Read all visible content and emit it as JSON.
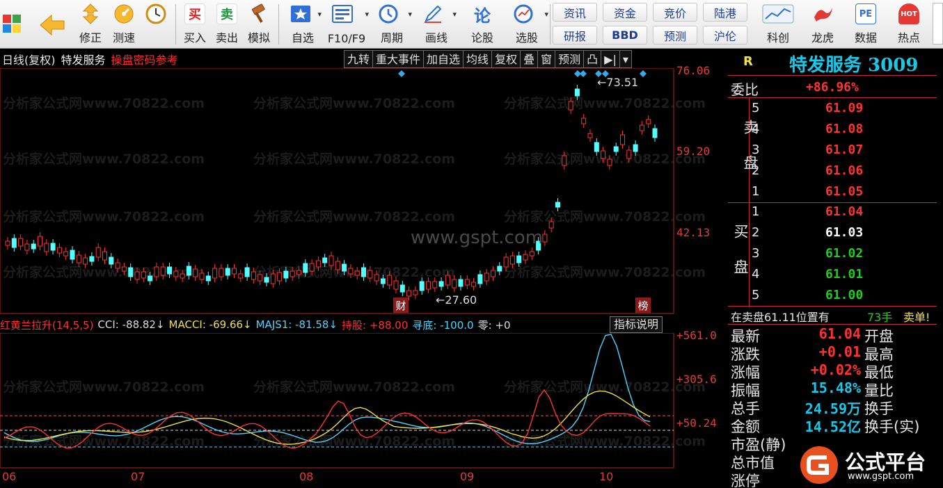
{
  "toolbar": {
    "buttons": [
      {
        "label": "",
        "icon": "windows-grid-icon"
      },
      {
        "label": "",
        "icon": "back-arrow-icon"
      },
      {
        "label": "修正",
        "icon": "up-down-arrows-icon"
      },
      {
        "label": "测速",
        "icon": "speed-dial-icon"
      },
      {
        "label": "买入",
        "icon": "buy-icon",
        "glyph": "买"
      },
      {
        "label": "卖出",
        "icon": "sell-icon",
        "glyph": "卖"
      },
      {
        "label": "模拟",
        "icon": "hammer-icon"
      },
      {
        "label": "自选",
        "icon": "star-icon"
      },
      {
        "label": "F10/F9",
        "icon": "info-card-icon"
      },
      {
        "label": "周期",
        "icon": "clock-icon"
      },
      {
        "label": "画线",
        "icon": "pencil-icon"
      },
      {
        "label": "论股",
        "icon": "discuss-icon",
        "glyph": "论"
      },
      {
        "label": "选股",
        "icon": "chart-select-icon"
      },
      {
        "label": "科创",
        "icon": "chart-icon"
      },
      {
        "label": "龙虎",
        "icon": "dragon-icon"
      },
      {
        "label": "数据",
        "icon": "pe-icon",
        "glyph": "PE"
      },
      {
        "label": "热点",
        "icon": "hot-icon",
        "glyph": "HOT"
      }
    ],
    "quick_row1": [
      "资讯",
      "资金",
      "竞价",
      "陆港"
    ],
    "quick_row2": [
      "研报",
      "BBD",
      "预测",
      "沪伦"
    ]
  },
  "chart": {
    "period": "日线(复权)",
    "stock_name": "特发服务",
    "hint": "操盘密码参考",
    "menu": [
      "九转",
      "重大事件",
      "加自选",
      "均线",
      "复权",
      "叠",
      "窗",
      "预测",
      "凸",
      "▶|",
      "▾"
    ],
    "price_axis": [
      "76.06",
      "59.20",
      "42.13"
    ],
    "high_label": "←73.51",
    "low_label": "←27.60",
    "marker_cai": "财",
    "marker_bang": "榜",
    "watermark": "分析家公式网www.70822.com",
    "center_watermark": "www.gspt.com",
    "months": [
      "06",
      "07",
      "08",
      "09",
      "10"
    ]
  },
  "indicator": {
    "name": "红黄兰拉升(14,5,5)",
    "cci": "CCI: -88.82↓",
    "macci": "MACCI: -69.66↓",
    "majs": "MAJS1: -81.58↓",
    "hold": "持股: +88.00",
    "bottom": "寻底: -100.0",
    "zero": "零: +0",
    "help_button": "指标说明",
    "axis": [
      "+561.0",
      "+305.6",
      "+50.24"
    ]
  },
  "quote": {
    "r_label": "R",
    "title": "特发服务 3009",
    "weibi_label": "委比",
    "weibi": "+86.96%",
    "sell_label": "卖盘",
    "buy_label": "买盘",
    "sell": [
      {
        "lvl": "5",
        "price": "61.09"
      },
      {
        "lvl": "4",
        "price": "61.08"
      },
      {
        "lvl": "3",
        "price": "61.07"
      },
      {
        "lvl": "2",
        "price": "61.06"
      },
      {
        "lvl": "1",
        "price": "61.05"
      }
    ],
    "buy": [
      {
        "lvl": "1",
        "price": "61.04"
      },
      {
        "lvl": "2",
        "price": "61.03"
      },
      {
        "lvl": "3",
        "price": "61.02"
      },
      {
        "lvl": "4",
        "price": "61.01"
      },
      {
        "lvl": "5",
        "price": "61.00"
      }
    ],
    "big_order": {
      "text": "在卖盘61.11位置有",
      "qty": "73手",
      "tag": "卖单!"
    },
    "stats": [
      {
        "k": "最新",
        "v": "61.04",
        "k2": "开盘"
      },
      {
        "k": "涨跌",
        "v": "+0.01",
        "k2": "最高"
      },
      {
        "k": "涨幅",
        "v": "+0.02%",
        "k2": "最低"
      },
      {
        "k": "振幅",
        "v": "15.48%",
        "k2": "量比"
      },
      {
        "k": "总手",
        "v": "24.59万",
        "k2": "换手"
      },
      {
        "k": "金额",
        "v": "14.52亿",
        "k2": "换手(实)"
      },
      {
        "k": "市盈(静)",
        "v": "",
        "k2": ""
      },
      {
        "k": "总市值",
        "v": "",
        "k2": ""
      },
      {
        "k": "涨停",
        "v": "",
        "k2": ""
      }
    ]
  },
  "logo": {
    "title": "公式平台",
    "url": "www.gspt.com"
  },
  "colors": {
    "up": "#ff3232",
    "down": "#54ffff",
    "accent": "#18c8e8"
  }
}
